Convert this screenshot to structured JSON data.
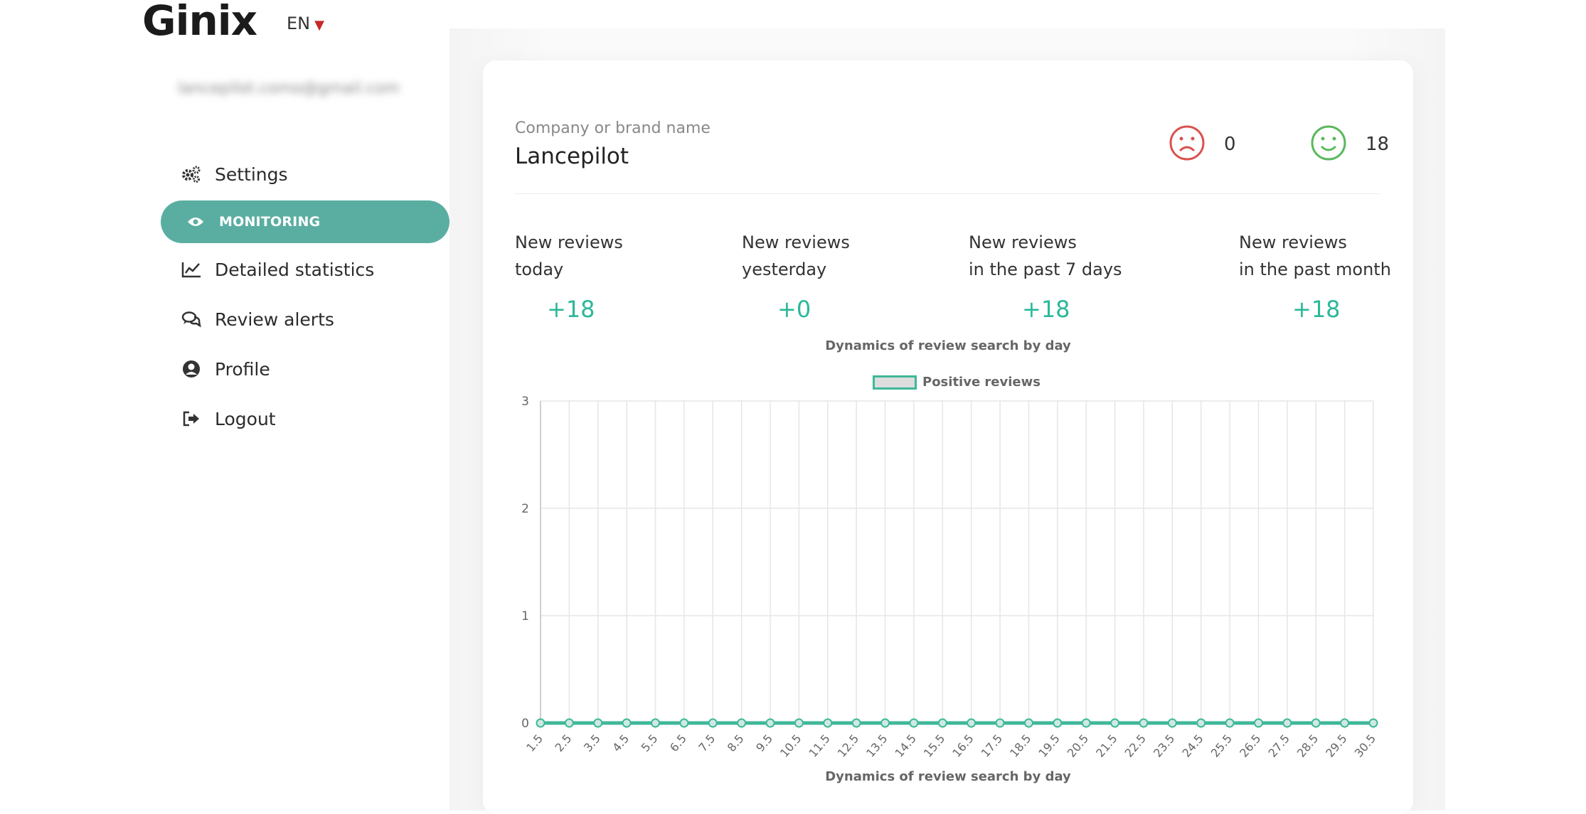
{
  "logo": {
    "text": "Ginix"
  },
  "language": {
    "current": "EN"
  },
  "user": {
    "email": "lancepilot.como@gmail.com"
  },
  "nav": {
    "settings": "Settings",
    "monitoring": "MONITORING",
    "detailed_statistics": "Detailed statistics",
    "review_alerts": "Review alerts",
    "profile": "Profile",
    "logout": "Logout"
  },
  "company": {
    "caption": "Company or brand name",
    "name": "Lancepilot"
  },
  "sentiment": {
    "negative": "0",
    "positive": "18",
    "negative_color": "#d9534f",
    "positive_color": "#5cb85c"
  },
  "stats": [
    {
      "line1": "New reviews",
      "line2": "today",
      "value": "+18"
    },
    {
      "line1": "New reviews",
      "line2": "yesterday",
      "value": "+0"
    },
    {
      "line1": "New reviews",
      "line2": "in the past 7 days",
      "value": "+18"
    },
    {
      "line1": "New reviews",
      "line2": "in the past month",
      "value": "+18"
    }
  ],
  "chart_data": {
    "type": "line",
    "title": "Dynamics of review search by day",
    "xlabel": "Dynamics of review search by day",
    "ylabel": "",
    "categories": [
      "1.5",
      "2.5",
      "3.5",
      "4.5",
      "5.5",
      "6.5",
      "7.5",
      "8.5",
      "9.5",
      "10.5",
      "11.5",
      "12.5",
      "13.5",
      "14.5",
      "15.5",
      "16.5",
      "17.5",
      "18.5",
      "19.5",
      "20.5",
      "21.5",
      "22.5",
      "23.5",
      "24.5",
      "25.5",
      "26.5",
      "27.5",
      "28.5",
      "29.5",
      "30.5"
    ],
    "series": [
      {
        "name": "Positive reviews",
        "values": [
          0,
          0,
          0,
          0,
          0,
          0,
          0,
          0,
          0,
          0,
          0,
          0,
          0,
          0,
          0,
          0,
          0,
          0,
          0,
          0,
          0,
          0,
          0,
          0,
          0,
          0,
          0,
          0,
          0,
          0
        ]
      }
    ],
    "ylim": [
      0,
      3
    ],
    "yticks": [
      "0",
      "1",
      "2",
      "3"
    ],
    "grid": true,
    "legend": "top-center",
    "series_color": "#3fb89a"
  }
}
